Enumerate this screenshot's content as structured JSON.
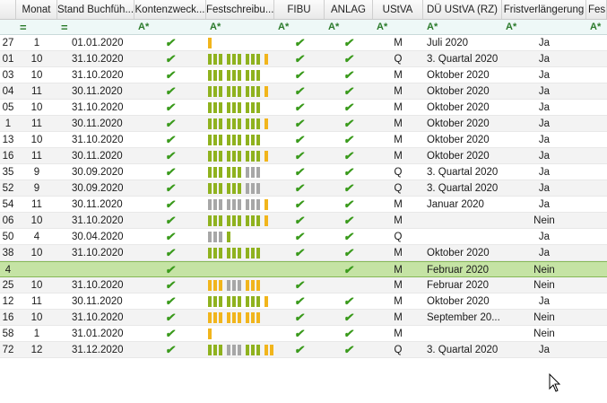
{
  "columns": {
    "id": "",
    "monat": "Monat",
    "stand": "Stand  Buchfüh...",
    "konto": "Kontenzweck...",
    "fest": "Festschreibu...",
    "fibu": "FIBU",
    "anlag": "ANLAG",
    "ustva": "UStVA",
    "du": "DÜ UStVA (RZ)",
    "frist": "Fristverlängerung",
    "fes2": "Fes"
  },
  "filter": {
    "text_icon": "A*",
    "equals_icon": "="
  },
  "colors": {
    "bar_green": "#8fb21e",
    "bar_gray": "#a7a7a7",
    "bar_orange": "#f1b51c",
    "check": "#3a9a1c",
    "selected_row": "#c5e3a4"
  },
  "rows": [
    {
      "id": "27",
      "monat": "1",
      "stand": "01.01.2020",
      "konto": "✔",
      "fest": "o",
      "fibu": "✔",
      "anlag": "✔",
      "ustva": "M",
      "du": "Juli 2020",
      "frist": "Ja"
    },
    {
      "id": "01",
      "monat": "10",
      "stand": "31.10.2020",
      "konto": "✔",
      "fest": "ggg ggg ggg o",
      "fibu": "✔",
      "anlag": "✔",
      "ustva": "Q",
      "du": "3. Quartal 2020",
      "frist": "Ja"
    },
    {
      "id": "03",
      "monat": "10",
      "stand": "31.10.2020",
      "konto": "✔",
      "fest": "ggg ggg ggg",
      "fibu": "✔",
      "anlag": "✔",
      "ustva": "M",
      "du": "Oktober 2020",
      "frist": "Ja"
    },
    {
      "id": "04",
      "monat": "11",
      "stand": "30.11.2020",
      "konto": "✔",
      "fest": "ggg ggg ggg o",
      "fibu": "✔",
      "anlag": "✔",
      "ustva": "M",
      "du": "Oktober 2020",
      "frist": "Ja"
    },
    {
      "id": "05",
      "monat": "10",
      "stand": "31.10.2020",
      "konto": "✔",
      "fest": "ggg ggg ggg",
      "fibu": "✔",
      "anlag": "✔",
      "ustva": "M",
      "du": "Oktober 2020",
      "frist": "Ja"
    },
    {
      "id": "1",
      "monat": "11",
      "stand": "30.11.2020",
      "konto": "✔",
      "fest": "ggg ggg ggg o",
      "fibu": "✔",
      "anlag": "✔",
      "ustva": "M",
      "du": "Oktober 2020",
      "frist": "Ja"
    },
    {
      "id": "13",
      "monat": "10",
      "stand": "31.10.2020",
      "konto": "✔",
      "fest": "ggg ggg ggg",
      "fibu": "✔",
      "anlag": "✔",
      "ustva": "M",
      "du": "Oktober 2020",
      "frist": "Ja"
    },
    {
      "id": "16",
      "monat": "11",
      "stand": "30.11.2020",
      "konto": "✔",
      "fest": "ggg ggg ggg o",
      "fibu": "✔",
      "anlag": "✔",
      "ustva": "M",
      "du": "Oktober 2020",
      "frist": "Ja"
    },
    {
      "id": "35",
      "monat": "9",
      "stand": "30.09.2020",
      "konto": "✔",
      "fest": "ggg ggg rrr",
      "fibu": "✔",
      "anlag": "✔",
      "ustva": "Q",
      "du": "3. Quartal 2020",
      "frist": "Ja"
    },
    {
      "id": "52",
      "monat": "9",
      "stand": "30.09.2020",
      "konto": "✔",
      "fest": "ggg ggg rrr",
      "fibu": "✔",
      "anlag": "✔",
      "ustva": "Q",
      "du": "3. Quartal 2020",
      "frist": "Ja"
    },
    {
      "id": "54",
      "monat": "11",
      "stand": "30.11.2020",
      "konto": "✔",
      "fest": "rrr rrr rrr o",
      "fibu": "✔",
      "anlag": "✔",
      "ustva": "M",
      "du": "Januar 2020",
      "frist": "Ja"
    },
    {
      "id": "06",
      "monat": "10",
      "stand": "31.10.2020",
      "konto": "✔",
      "fest": "ggg ggg ggg o",
      "fibu": "✔",
      "anlag": "✔",
      "ustva": "M",
      "du": "",
      "frist": "Nein"
    },
    {
      "id": "50",
      "monat": "4",
      "stand": "30.04.2020",
      "konto": "✔",
      "fest": "rrr g",
      "fibu": "✔",
      "anlag": "✔",
      "ustva": "Q",
      "du": "",
      "frist": "Ja"
    },
    {
      "id": "38",
      "monat": "10",
      "stand": "31.10.2020",
      "konto": "✔",
      "fest": "ggg ggg ggg",
      "fibu": "✔",
      "anlag": "✔",
      "ustva": "M",
      "du": "Oktober 2020",
      "frist": "Ja"
    },
    {
      "id": "4",
      "monat": "",
      "stand": "",
      "konto": "✔",
      "fest": "",
      "fibu": "",
      "anlag": "✔",
      "ustva": "M",
      "du": "Februar 2020",
      "frist": "Nein",
      "selected": true
    },
    {
      "id": "25",
      "monat": "10",
      "stand": "31.10.2020",
      "konto": "✔",
      "fest": "ooo rrr ooo",
      "fibu": "✔",
      "anlag": "",
      "ustva": "M",
      "du": "Februar 2020",
      "frist": "Nein"
    },
    {
      "id": "12",
      "monat": "11",
      "stand": "30.11.2020",
      "konto": "✔",
      "fest": "ggg ggg ggg o",
      "fibu": "✔",
      "anlag": "✔",
      "ustva": "M",
      "du": "Oktober 2020",
      "frist": "Ja"
    },
    {
      "id": "16",
      "monat": "10",
      "stand": "31.10.2020",
      "konto": "✔",
      "fest": "ooo ooo ooo",
      "fibu": "✔",
      "anlag": "✔",
      "ustva": "M",
      "du": "September  20...",
      "frist": "Nein"
    },
    {
      "id": "58",
      "monat": "1",
      "stand": "31.01.2020",
      "konto": "✔",
      "fest": "o",
      "fibu": "✔",
      "anlag": "✔",
      "ustva": "M",
      "du": "",
      "frist": "Nein"
    },
    {
      "id": "72",
      "monat": "12",
      "stand": "31.12.2020",
      "konto": "✔",
      "fest": "ggg rrr ggg oo",
      "fibu": "✔",
      "anlag": "✔",
      "ustva": "Q",
      "du": "3. Quartal 2020",
      "frist": "Ja"
    }
  ]
}
